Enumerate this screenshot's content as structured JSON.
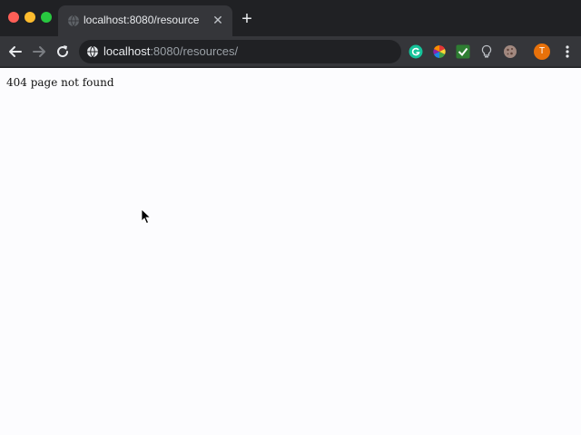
{
  "window": {
    "controls": [
      "close",
      "minimize",
      "maximize"
    ]
  },
  "tab": {
    "title": "localhost:8080/resource",
    "favicon": "globe-icon",
    "close_icon": "close-icon"
  },
  "new_tab": {
    "label": "+"
  },
  "toolbar": {
    "back_icon": "arrow-back-icon",
    "forward_icon": "arrow-forward-icon",
    "reload_icon": "reload-icon",
    "address": {
      "icon": "globe-icon",
      "host": "localhost",
      "rest": ":8080/resources/"
    },
    "extensions": [
      "grammarly-icon",
      "color-wheel-icon",
      "checkmark-icon",
      "lightbulb-icon",
      "cookie-icon"
    ],
    "avatar_initial": "T",
    "menu_icon": "kebab-menu-icon"
  },
  "page": {
    "body_text": "404 page not found"
  },
  "colors": {
    "tabstrip": "#202124",
    "toolbar": "#35363a",
    "page_bg": "#fcfcfe",
    "avatar": "#e8710a"
  }
}
